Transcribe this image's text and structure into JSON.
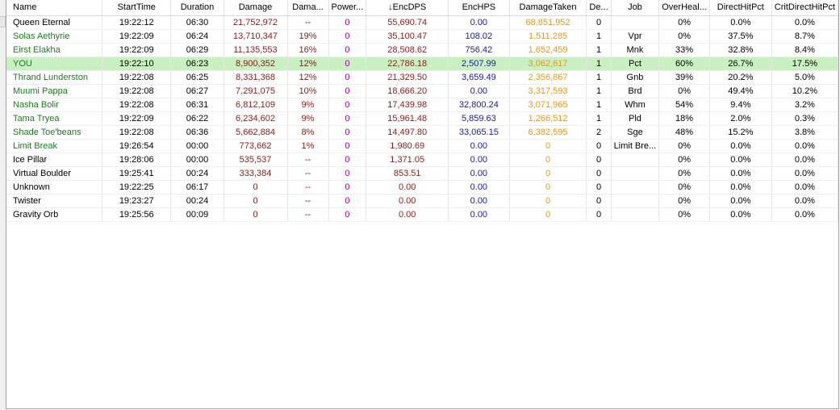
{
  "colors": {
    "player_green": "#1e7a1e",
    "damage_red": "#8b1a1a",
    "heal_blue": "#1a1aa0",
    "taken_orange": "#e8961c",
    "power_purple": "#9a00b0",
    "highlight_row": "#c8f0c0"
  },
  "table": {
    "columns": [
      "Name",
      "StartTime",
      "Duration",
      "Damage",
      "Dama...",
      "Power...",
      "↓EncDPS",
      "EncHPS",
      "DamageTaken",
      "De...",
      "Job",
      "OverHeal...",
      "DirectHitPct",
      "CritDirectHitPct"
    ],
    "rows": [
      {
        "name": "Queen Eternal",
        "player": false,
        "you": false,
        "start": "19:22:12",
        "duration": "06:30",
        "damage": "21,752,972",
        "dmg_pct": "--",
        "power": "0",
        "encdps": "55,690.74",
        "enchps": "0.00",
        "taken": "68,851,952",
        "deaths": "0",
        "job": "",
        "overheal": "0%",
        "dh": "0.0%",
        "cdh": "0.0%"
      },
      {
        "name": "Solas Aethyrie",
        "player": true,
        "you": false,
        "start": "19:22:09",
        "duration": "06:24",
        "damage": "13,710,347",
        "dmg_pct": "19%",
        "power": "0",
        "encdps": "35,100.47",
        "enchps": "108.02",
        "taken": "1,511,285",
        "deaths": "1",
        "job": "Vpr",
        "overheal": "0%",
        "dh": "37.5%",
        "cdh": "8.7%"
      },
      {
        "name": "Eirst Elakha",
        "player": true,
        "you": false,
        "start": "19:22:09",
        "duration": "06:29",
        "damage": "11,135,553",
        "dmg_pct": "16%",
        "power": "0",
        "encdps": "28,508.62",
        "enchps": "756.42",
        "taken": "1,652,459",
        "deaths": "1",
        "job": "Mnk",
        "overheal": "33%",
        "dh": "32.8%",
        "cdh": "8.4%"
      },
      {
        "name": "YOU",
        "player": true,
        "you": true,
        "start": "19:22:10",
        "duration": "06:23",
        "damage": "8,900,352",
        "dmg_pct": "12%",
        "power": "0",
        "encdps": "22,786.18",
        "enchps": "2,507.99",
        "taken": "3,062,617",
        "deaths": "1",
        "job": "Pct",
        "overheal": "60%",
        "dh": "26.7%",
        "cdh": "17.5%"
      },
      {
        "name": "Thrand Lunderston",
        "player": true,
        "you": false,
        "start": "19:22:08",
        "duration": "06:25",
        "damage": "8,331,368",
        "dmg_pct": "12%",
        "power": "0",
        "encdps": "21,329.50",
        "enchps": "3,659.49",
        "taken": "2,356,867",
        "deaths": "1",
        "job": "Gnb",
        "overheal": "39%",
        "dh": "20.2%",
        "cdh": "5.0%"
      },
      {
        "name": "Muumi Pappa",
        "player": true,
        "you": false,
        "start": "19:22:08",
        "duration": "06:27",
        "damage": "7,291,075",
        "dmg_pct": "10%",
        "power": "0",
        "encdps": "18,666.20",
        "enchps": "0.00",
        "taken": "3,317,593",
        "deaths": "1",
        "job": "Brd",
        "overheal": "0%",
        "dh": "49.4%",
        "cdh": "10.2%"
      },
      {
        "name": "Nasha Bolir",
        "player": true,
        "you": false,
        "start": "19:22:08",
        "duration": "06:31",
        "damage": "6,812,109",
        "dmg_pct": "9%",
        "power": "0",
        "encdps": "17,439.98",
        "enchps": "32,800.24",
        "taken": "3,071,965",
        "deaths": "1",
        "job": "Whm",
        "overheal": "54%",
        "dh": "9.4%",
        "cdh": "3.2%"
      },
      {
        "name": "Tama Tryea",
        "player": true,
        "you": false,
        "start": "19:22:09",
        "duration": "06:22",
        "damage": "6,234,602",
        "dmg_pct": "9%",
        "power": "0",
        "encdps": "15,961.48",
        "enchps": "5,859.63",
        "taken": "1,266,512",
        "deaths": "1",
        "job": "Pld",
        "overheal": "18%",
        "dh": "2.0%",
        "cdh": "0.3%"
      },
      {
        "name": "Shade Toe'beans",
        "player": true,
        "you": false,
        "start": "19:22:08",
        "duration": "06:36",
        "damage": "5,662,884",
        "dmg_pct": "8%",
        "power": "0",
        "encdps": "14,497.80",
        "enchps": "33,065.15",
        "taken": "6,382,595",
        "deaths": "2",
        "job": "Sge",
        "overheal": "48%",
        "dh": "15.2%",
        "cdh": "3.8%"
      },
      {
        "name": "Limit Break",
        "player": true,
        "you": false,
        "start": "19:26:54",
        "duration": "00:00",
        "damage": "773,662",
        "dmg_pct": "1%",
        "power": "0",
        "encdps": "1,980.69",
        "enchps": "0.00",
        "taken": "0",
        "deaths": "0",
        "job": "Limit Bre...",
        "overheal": "0%",
        "dh": "0.0%",
        "cdh": "0.0%"
      },
      {
        "name": "Ice Pillar",
        "player": false,
        "you": false,
        "start": "19:28:06",
        "duration": "00:00",
        "damage": "535,537",
        "dmg_pct": "--",
        "power": "0",
        "encdps": "1,371.05",
        "enchps": "0.00",
        "taken": "0",
        "deaths": "0",
        "job": "",
        "overheal": "0%",
        "dh": "0.0%",
        "cdh": "0.0%"
      },
      {
        "name": "Virtual Boulder",
        "player": false,
        "you": false,
        "start": "19:25:41",
        "duration": "00:24",
        "damage": "333,384",
        "dmg_pct": "--",
        "power": "0",
        "encdps": "853.51",
        "enchps": "0.00",
        "taken": "0",
        "deaths": "0",
        "job": "",
        "overheal": "0%",
        "dh": "0.0%",
        "cdh": "0.0%"
      },
      {
        "name": "Unknown",
        "player": false,
        "you": false,
        "start": "19:22:25",
        "duration": "06:17",
        "damage": "0",
        "dmg_pct": "--",
        "power": "0",
        "encdps": "0.00",
        "enchps": "0.00",
        "taken": "0",
        "deaths": "0",
        "job": "",
        "overheal": "0%",
        "dh": "0.0%",
        "cdh": "0.0%"
      },
      {
        "name": "Twister",
        "player": false,
        "you": false,
        "start": "19:23:27",
        "duration": "00:24",
        "damage": "0",
        "dmg_pct": "--",
        "power": "0",
        "encdps": "0.00",
        "enchps": "0.00",
        "taken": "0",
        "deaths": "0",
        "job": "",
        "overheal": "0%",
        "dh": "0.0%",
        "cdh": "0.0%"
      },
      {
        "name": "Gravity Orb",
        "player": false,
        "you": false,
        "start": "19:25:56",
        "duration": "00:09",
        "damage": "0",
        "dmg_pct": "--",
        "power": "0",
        "encdps": "0.00",
        "enchps": "0.00",
        "taken": "0",
        "deaths": "0",
        "job": "",
        "overheal": "0%",
        "dh": "0.0%",
        "cdh": "0.0%"
      }
    ]
  }
}
